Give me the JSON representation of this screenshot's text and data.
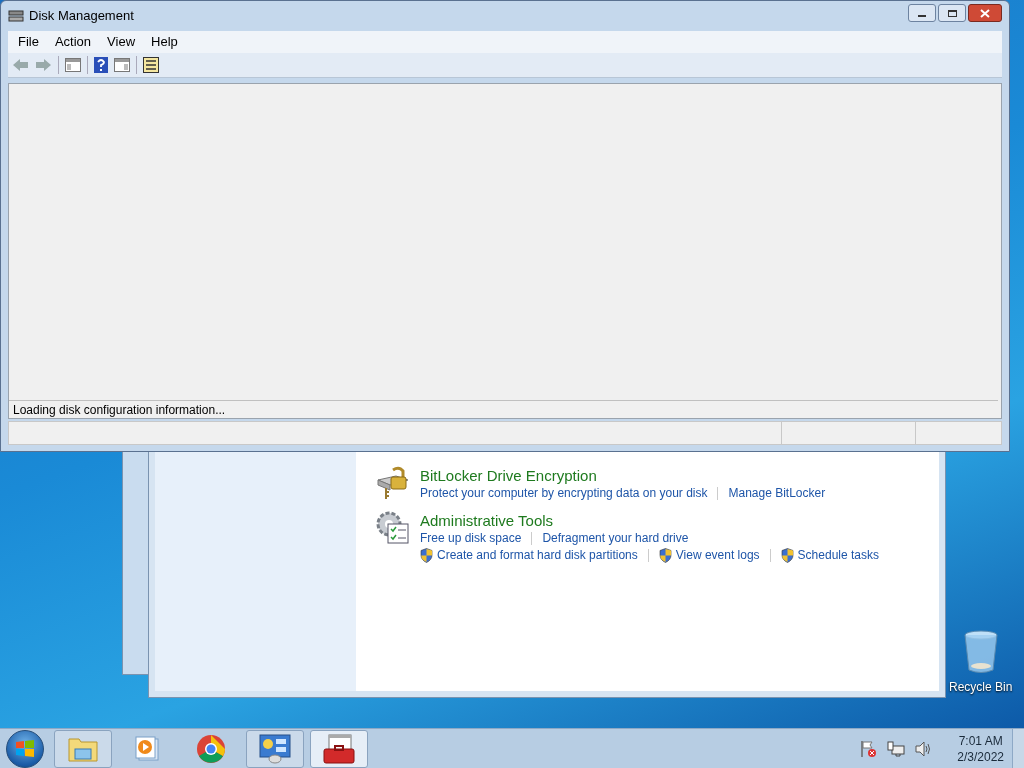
{
  "disk_management": {
    "title": "Disk Management",
    "menu": [
      "File",
      "Action",
      "View",
      "Help"
    ],
    "status_message": "Loading disk configuration information..."
  },
  "control_panel": {
    "sections": [
      {
        "kind": "bitlocker",
        "title": "BitLocker Drive Encryption",
        "rows": [
          [
            {
              "text": "Protect your computer by encrypting data on your disk",
              "shield": false
            },
            {
              "text": "Manage BitLocker",
              "shield": false
            }
          ]
        ]
      },
      {
        "kind": "admin",
        "title": "Administrative Tools",
        "rows": [
          [
            {
              "text": "Free up disk space",
              "shield": false
            },
            {
              "text": "Defragment your hard drive",
              "shield": false
            }
          ],
          [
            {
              "text": "Create and format hard disk partitions",
              "shield": true
            },
            {
              "text": "View event logs",
              "shield": true
            },
            {
              "text": "Schedule tasks",
              "shield": true
            }
          ]
        ]
      }
    ]
  },
  "desktop_icons": [
    {
      "label": "Recycle Bin"
    }
  ],
  "taskbar": {
    "items": [
      {
        "kind": "folder",
        "running": true,
        "active": false
      },
      {
        "kind": "media",
        "running": false,
        "active": false
      },
      {
        "kind": "browser",
        "running": false,
        "active": false
      },
      {
        "kind": "control-panel",
        "running": true,
        "active": false
      },
      {
        "kind": "toolbox",
        "running": true,
        "active": true
      }
    ],
    "time": "7:01 AM",
    "date": "2/3/2022"
  }
}
